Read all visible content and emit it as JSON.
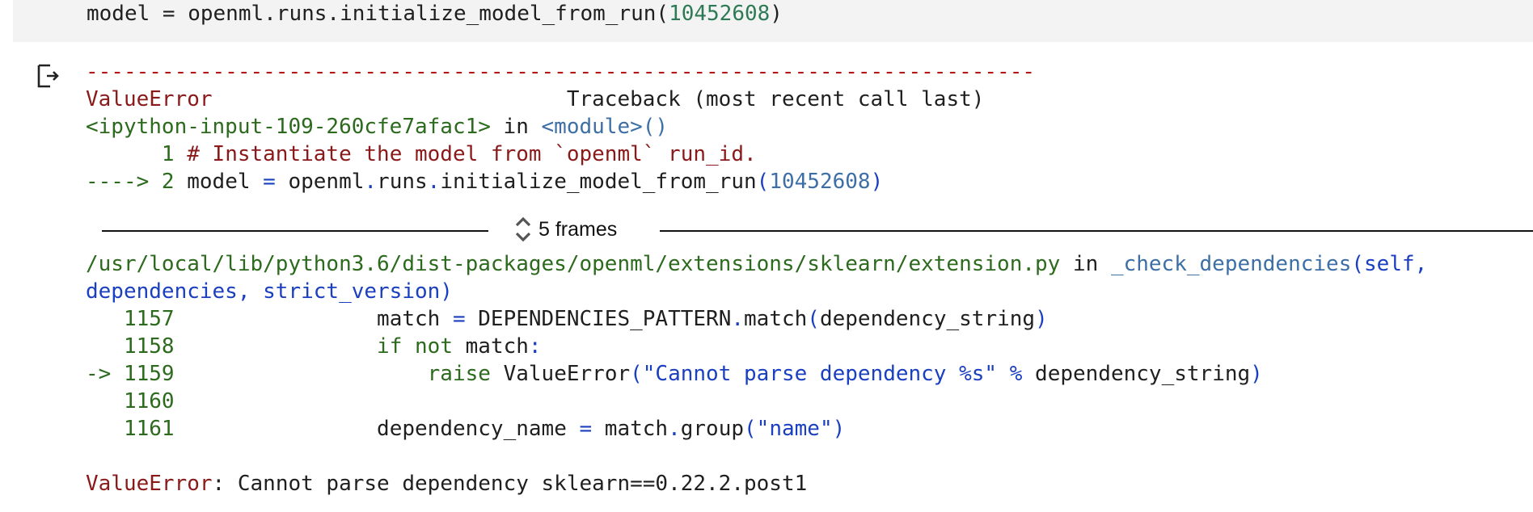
{
  "code_cell": {
    "line_prefix": "model = openml.runs.initialize_model_from_run(",
    "line_number": "10452608",
    "line_suffix": ")"
  },
  "output": {
    "separator": "---------------------------------------------------------------------------",
    "error_type": "ValueError",
    "traceback_pad": "                            ",
    "traceback_header": "Traceback (most recent call last)",
    "input_ref": "<ipython-input-109-260cfe7afac1>",
    "in_word": " in ",
    "module_ref": "<module>()",
    "line1_prefix": "      1 ",
    "line1_comment": "# Instantiate the model from `openml` run_id.",
    "line2_arrow": "----> 2 ",
    "line2_a": "model ",
    "line2_eq": "=",
    "line2_b": " openml",
    "line2_dot1": ".",
    "line2_c": "runs",
    "line2_dot2": ".",
    "line2_d": "initialize_model_from_run",
    "line2_paren": "(",
    "line2_num": "10452608",
    "line2_close": ")",
    "frames_label": "5 frames",
    "file_path": "/usr/local/lib/python3.6/dist-packages/openml/extensions/sklearn/extension.py",
    "in_word2": " in ",
    "func_name": "_check_dependencies",
    "func_args1": "(self,",
    "func_args2": "dependencies, strict_version)",
    "src": [
      {
        "prefix": "   1157 ",
        "indent": "               ",
        "parts": [
          {
            "t": "match ",
            "c": "dark"
          },
          {
            "t": "=",
            "c": "blue"
          },
          {
            "t": " DEPENDENCIES_PATTERN",
            "c": "dark"
          },
          {
            "t": ".",
            "c": "blue"
          },
          {
            "t": "match",
            "c": "dark"
          },
          {
            "t": "(",
            "c": "blue"
          },
          {
            "t": "dependency_string",
            "c": "dark"
          },
          {
            "t": ")",
            "c": "blue"
          }
        ]
      },
      {
        "prefix": "   1158 ",
        "indent": "               ",
        "parts": [
          {
            "t": "if",
            "c": "green"
          },
          {
            "t": " ",
            "c": "dark"
          },
          {
            "t": "not",
            "c": "green"
          },
          {
            "t": " match",
            "c": "dark"
          },
          {
            "t": ":",
            "c": "blue"
          }
        ]
      },
      {
        "prefix": "-> 1159 ",
        "indent": "                   ",
        "parts": [
          {
            "t": "raise",
            "c": "green"
          },
          {
            "t": " ValueError",
            "c": "dark"
          },
          {
            "t": "(",
            "c": "blue"
          },
          {
            "t": "\"Cannot parse dependency %s\"",
            "c": "blue"
          },
          {
            "t": " ",
            "c": "dark"
          },
          {
            "t": "%",
            "c": "blue"
          },
          {
            "t": " dependency_string",
            "c": "dark"
          },
          {
            "t": ")",
            "c": "blue"
          }
        ]
      },
      {
        "prefix": "   1160 ",
        "indent": "",
        "parts": []
      },
      {
        "prefix": "   1161 ",
        "indent": "               ",
        "parts": [
          {
            "t": "dependency_name ",
            "c": "dark"
          },
          {
            "t": "=",
            "c": "blue"
          },
          {
            "t": " match",
            "c": "dark"
          },
          {
            "t": ".",
            "c": "blue"
          },
          {
            "t": "group",
            "c": "dark"
          },
          {
            "t": "(",
            "c": "blue"
          },
          {
            "t": "\"name\"",
            "c": "blue"
          },
          {
            "t": ")",
            "c": "blue"
          }
        ]
      }
    ],
    "final_error_type": "ValueError",
    "final_error_msg": ": Cannot parse dependency sklearn==0.22.2.post1"
  },
  "icons": {
    "output": "output-arrow-icon",
    "frames": "chevron-up-down-icon"
  }
}
